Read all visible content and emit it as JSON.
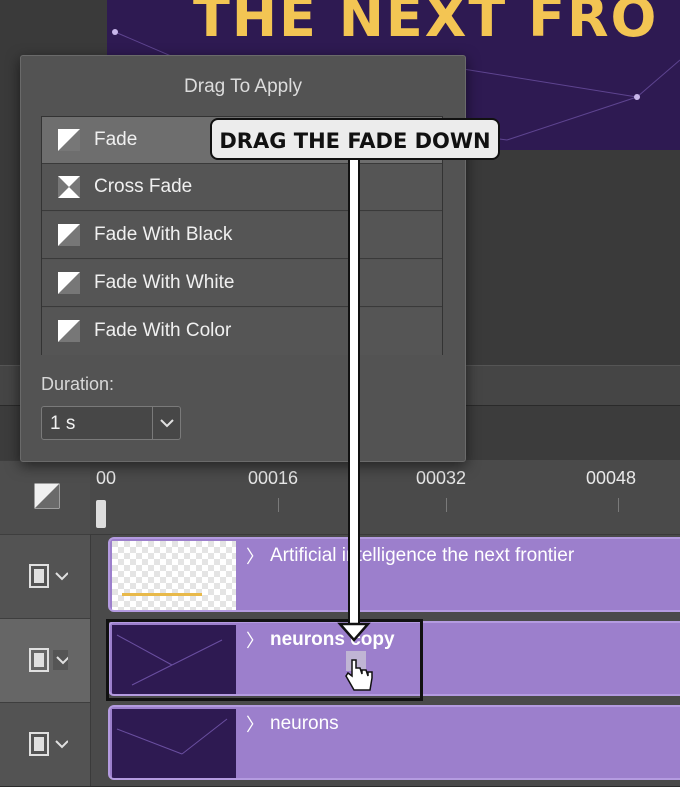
{
  "preview": {
    "canvas_title": "THE NEXT FRO"
  },
  "panel": {
    "title": "Drag To Apply",
    "items": [
      {
        "label": "Fade",
        "icon": "fade-icon"
      },
      {
        "label": "Cross Fade",
        "icon": "cross-fade-icon"
      },
      {
        "label": "Fade With Black",
        "icon": "fade-icon"
      },
      {
        "label": "Fade With White",
        "icon": "fade-icon"
      },
      {
        "label": "Fade With Color",
        "icon": "fade-icon"
      }
    ],
    "duration_label": "Duration:",
    "duration_value": "1 s"
  },
  "timeline": {
    "ticks": [
      "00",
      "00016",
      "00032",
      "00048"
    ],
    "tracks": [
      {
        "clip_name": "Artificial intelligence the next frontier"
      },
      {
        "clip_name": "neurons copy"
      },
      {
        "clip_name": "neurons"
      }
    ]
  },
  "annotation": {
    "callout": "DRAG THE FADE DOWN"
  },
  "colors": {
    "clip": "#9c7fcc",
    "canvas_bg": "#2e1a52",
    "title_accent": "#f3c553",
    "panel_bg": "#535353"
  }
}
